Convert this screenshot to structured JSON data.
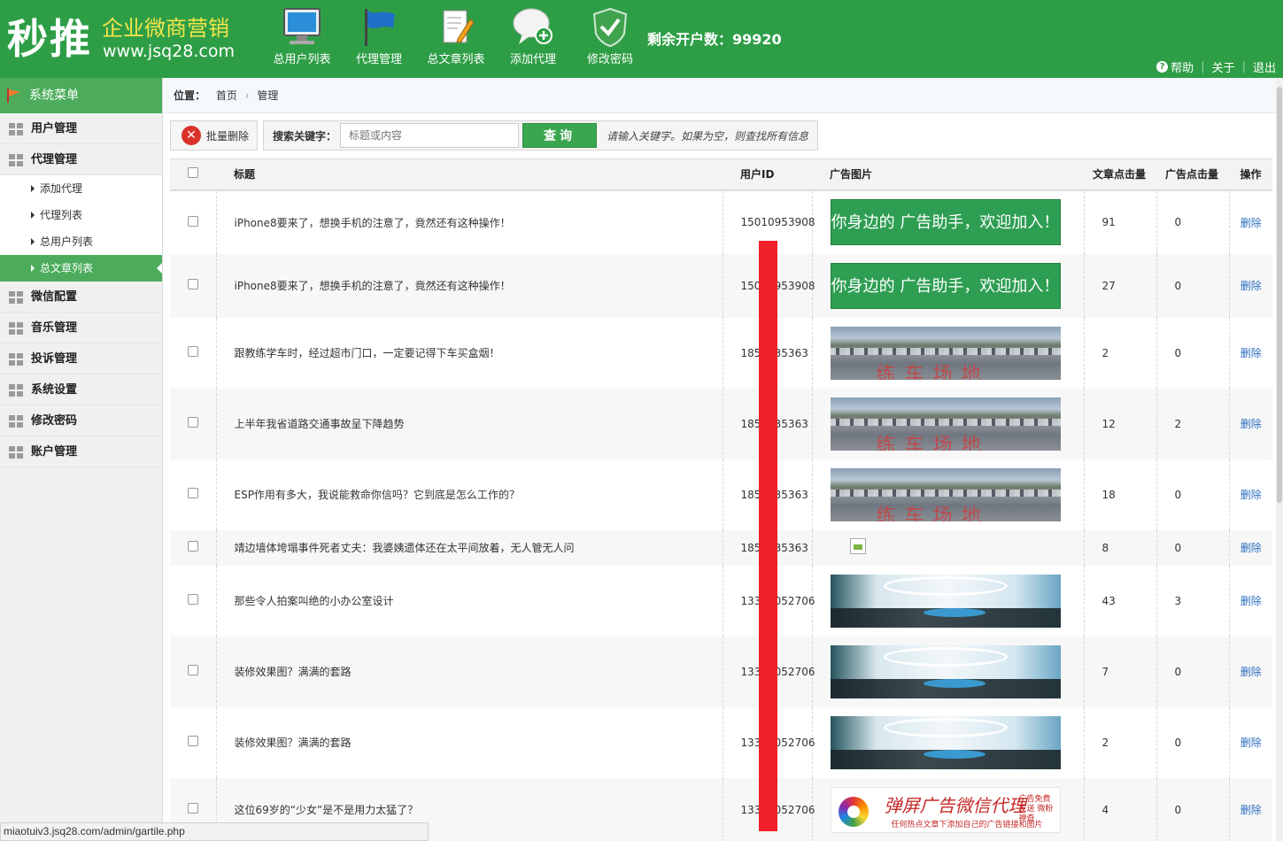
{
  "header": {
    "logo_main": "秒推",
    "logo_sub": "企业微商营销",
    "logo_url": "www.jsq28.com",
    "nav": [
      {
        "label": "总用户列表",
        "icon": "monitor-icon"
      },
      {
        "label": "代理管理",
        "icon": "flag-icon"
      },
      {
        "label": "总文章列表",
        "icon": "document-edit-icon"
      },
      {
        "label": "添加代理",
        "icon": "chat-add-icon"
      },
      {
        "label": "修改密码",
        "icon": "shield-check-icon"
      }
    ],
    "remain": "剩余开户数：99920",
    "links": {
      "help": "帮助",
      "about": "关于",
      "logout": "退出"
    }
  },
  "sidebar": {
    "title": "系统菜单",
    "groups": [
      {
        "label": "用户管理"
      },
      {
        "label": "代理管理",
        "children": [
          {
            "label": "添加代理"
          },
          {
            "label": "代理列表"
          },
          {
            "label": "总用户列表"
          },
          {
            "label": "总文章列表",
            "active": true
          }
        ]
      },
      {
        "label": "微信配置"
      },
      {
        "label": "音乐管理"
      },
      {
        "label": "投诉管理"
      },
      {
        "label": "系统设置"
      },
      {
        "label": "修改密码"
      },
      {
        "label": "账户管理"
      }
    ]
  },
  "breadcrumb": {
    "label": "位置：",
    "items": [
      "首页",
      "管理"
    ]
  },
  "toolbar": {
    "bulk_delete": "批量删除",
    "search_label": "搜索关键字：",
    "search_placeholder": "标题或内容",
    "query": "查询",
    "hint": "请输入关键字。如果为空，则查找所有信息"
  },
  "table": {
    "headers": {
      "title": "标题",
      "uid": "用户ID",
      "pic": "广告图片",
      "article_clicks": "文章点击量",
      "ad_clicks": "广告点击量",
      "op": "操作"
    },
    "rows": [
      {
        "title": "iPhone8要来了，想换手机的注意了，竟然还有这种操作！",
        "uid": "15010953908",
        "pic": "green",
        "pic_text": "你身边的 广告助手，欢迎加入！",
        "article_clicks": "91",
        "ad_clicks": "0",
        "op": "删除"
      },
      {
        "title": "iPhone8要来了，想换手机的注意了，竟然还有这种操作！",
        "uid": "150    953908",
        "pic": "green",
        "pic_text": "你身边的 广告助手，欢迎加入！",
        "article_clicks": "27",
        "ad_clicks": "0",
        "op": "删除"
      },
      {
        "title": "跟教练学车时，经过超市门口，一定要记得下车买盒烟！",
        "uid": "185    35363",
        "pic": "road",
        "pic_text": "练车场地",
        "article_clicks": "2",
        "ad_clicks": "0",
        "op": "删除"
      },
      {
        "title": "上半年我省道路交通事故呈下降趋势",
        "uid": "185    35363",
        "pic": "road",
        "pic_text": "练车场地",
        "article_clicks": "12",
        "ad_clicks": "2",
        "op": "删除"
      },
      {
        "title": "ESP作用有多大，我说能救命你信吗？它到底是怎么工作的？",
        "uid": "185    35363",
        "pic": "road",
        "pic_text": "练车场地",
        "article_clicks": "18",
        "ad_clicks": "0",
        "op": "删除"
      },
      {
        "title": "靖边墙体垮塌事件死者丈夫：我婆姨遗体还在太平间放着，无人管无人问",
        "uid": "185    35363",
        "pic": "broken",
        "pic_text": "",
        "article_clicks": "8",
        "ad_clicks": "0",
        "op": "删除"
      },
      {
        "title": "那些令人拍案叫绝的小办公室设计",
        "uid": "133    052706",
        "pic": "office",
        "pic_text": "",
        "article_clicks": "43",
        "ad_clicks": "3",
        "op": "删除"
      },
      {
        "title": "装修效果图？满满的套路",
        "uid": "133    052706",
        "pic": "office",
        "pic_text": "",
        "article_clicks": "7",
        "ad_clicks": "0",
        "op": "删除"
      },
      {
        "title": "装修效果图？满满的套路",
        "uid": "133    052706",
        "pic": "office",
        "pic_text": "",
        "article_clicks": "2",
        "ad_clicks": "0",
        "op": "删除"
      },
      {
        "title": "这位69岁的“少女”是不是用力太猛了？",
        "uid": "133    052706",
        "pic": "logo",
        "pic_text": "弹屏广告微信代理",
        "pic_sub": "任何热点文章下添加自己的广告链接和图片",
        "pic_side": "广告免费发送  微粉神奇",
        "article_clicks": "4",
        "ad_clicks": "0",
        "op": "删除"
      }
    ]
  },
  "statusbar": "miaotuiv3.jsq28.com/admin/gartile.php"
}
